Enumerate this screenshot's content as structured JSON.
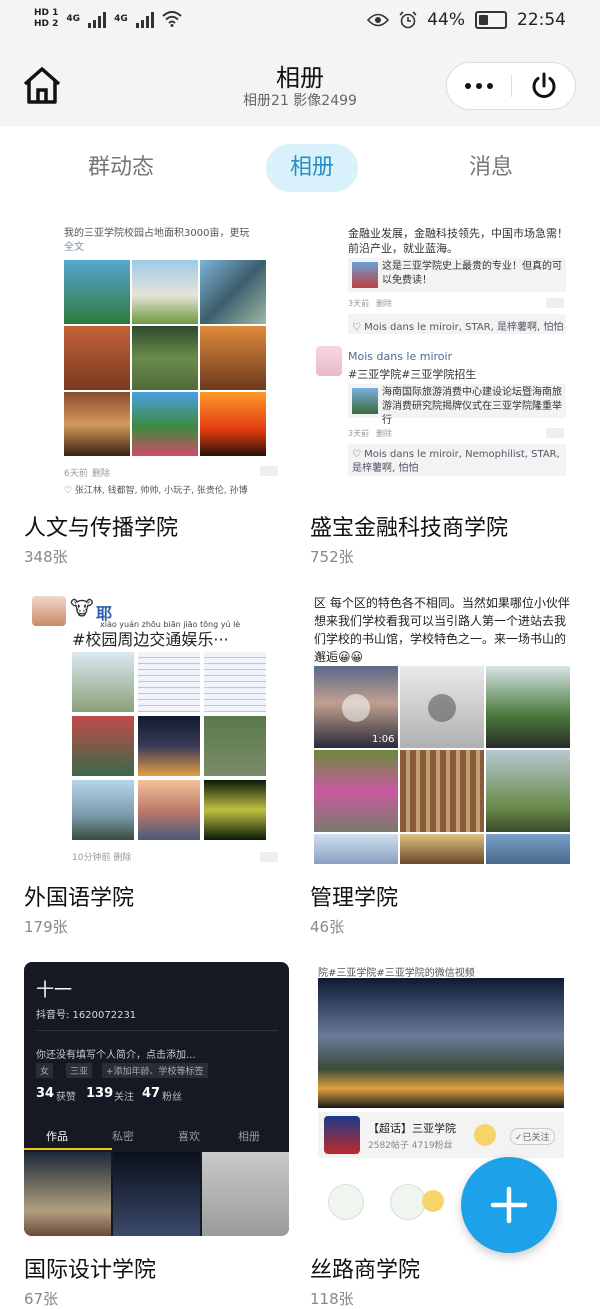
{
  "status_bar": {
    "hd1": "HD 1",
    "hd2": "HD 2",
    "net1": "4G",
    "net2": "4G",
    "battery": "44%",
    "battery_level": 0.44,
    "time": "22:54"
  },
  "header": {
    "title": "相册",
    "subtitle": "相册21 影像2499"
  },
  "tabs": [
    {
      "label": "群动态",
      "active": false
    },
    {
      "label": "相册",
      "active": true
    },
    {
      "label": "消息",
      "active": false
    }
  ],
  "albums": [
    {
      "name": "人文与传播学院",
      "count": "348张",
      "thumb": {
        "top_text": "我的三亚学院校园占地面积3000亩，更玩",
        "more": "全文",
        "date": "6天前",
        "delete": "删除",
        "bottom": "♡ 张江林, 钱都智, 帅帅, 小玩子, 张贵伦, 孙博"
      }
    },
    {
      "name": "盛宝金融科技商学院",
      "count": "752张",
      "thumb": {
        "top_text": "金融业发展，金融科技领先，中国市场急需！前沿产业，就业蓝海。",
        "link1": "这是三亚学院史上最贵的专业！但真的可以免费读！",
        "date1": "3天前",
        "delete1": "删除",
        "likes1": "♡ Mois dans le miroir, STAR, 是梓薯啊, 怕怕",
        "author": "Mois dans le miroir",
        "tags": "#三亚学院#三亚学院招生",
        "link2": "海南国际旅游消费中心建设论坛暨海南旅游消费研究院揭牌仪式在三亚学院隆重举行",
        "date2": "3天前",
        "delete2": "删除",
        "likes2": "♡ Mois dans le miroir, Nemophilist, STAR, 是梓薯啊, 怕怕"
      }
    },
    {
      "name": "外国语学院",
      "count": "179张",
      "thumb": {
        "emoji": "🐮",
        "char": "耶",
        "pinyin": "xiào yuán zhōu biān jiāo tōng yú lè",
        "headline": "#校园周边交通娱乐···",
        "bottom": "10分钟前 删除"
      }
    },
    {
      "name": "管理学院",
      "count": "46张",
      "thumb": {
        "text": "区 每个区的特色各不相同。当然如果哪位小伙伴想来我们学校看我可以当引路人第一个进站去我们学校的书山馆，学校特色之一。来一场书山的邂逅😀😀",
        "duration": "1:06"
      }
    },
    {
      "name": "国际设计学院",
      "count": "67张",
      "thumb": {
        "nick": "十一",
        "douyin_id": "抖音号: 1620072231",
        "intro": "你还没有填写个人简介，点击添加...",
        "tags": [
          "女",
          "三亚",
          "+添加年龄、学校等标签"
        ],
        "likes": "34",
        "likes_label": "获赞",
        "following": "139",
        "following_label": "关注",
        "fans": "47",
        "fans_label": "粉丝",
        "tab_works": "作品",
        "tab_private": "私密",
        "tab_like": "喜欢",
        "tab_album": "相册"
      }
    },
    {
      "name": "丝路商学院",
      "count": "118张",
      "thumb": {
        "top_text": "院#三亚学院#三亚学院的微信视频",
        "topic": "【超话】三亚学院",
        "stats": "2582帖子 4719粉丝",
        "followed": "✓已关注"
      }
    }
  ],
  "fab": {
    "label": "+"
  },
  "colors": {
    "accent": "#2a8fc4",
    "tab_active_bg": "#d9f1fa",
    "fab": "#1da1e8"
  }
}
